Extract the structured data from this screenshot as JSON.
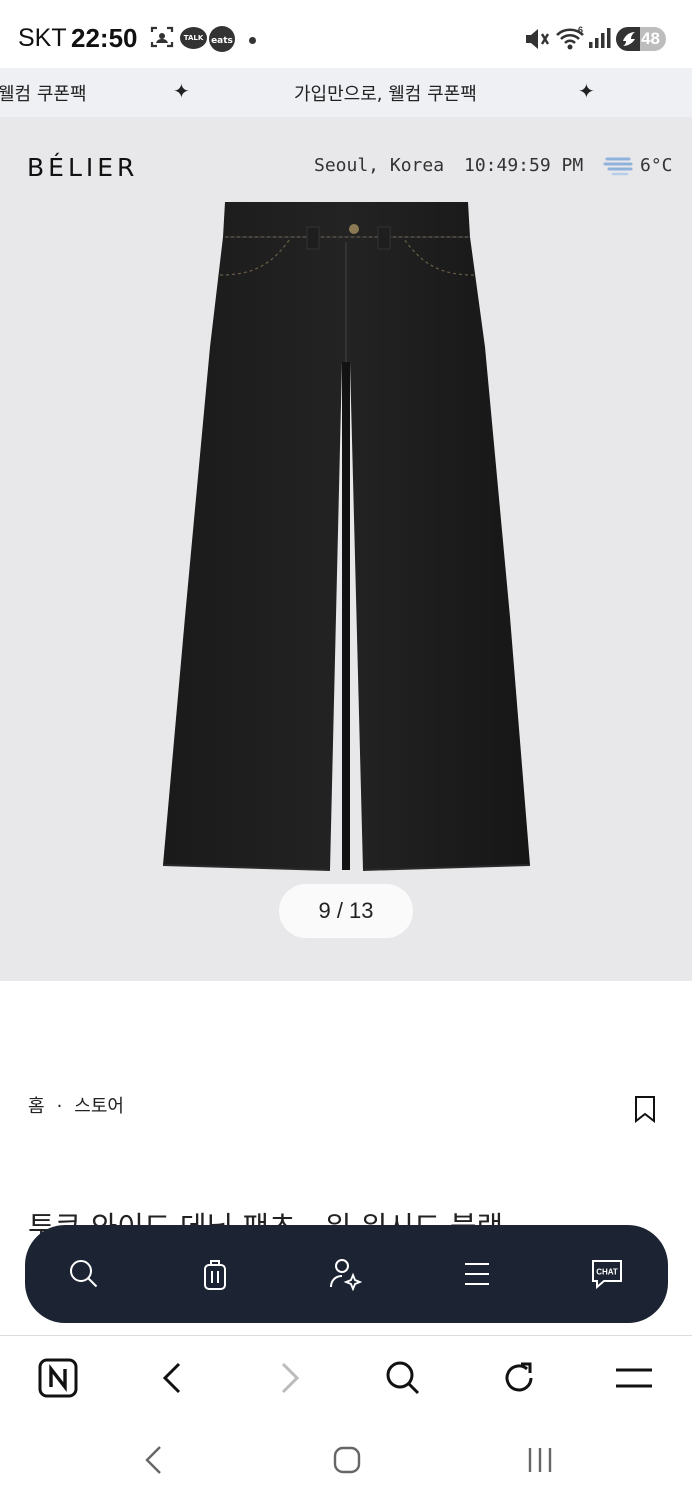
{
  "status_bar": {
    "carrier": "SKT",
    "time": "22:50",
    "talk_label": "TALK",
    "eats_label": "eats",
    "battery": "48",
    "wifi_badge": "6"
  },
  "promo": {
    "left_text": "웰컴 쿠폰팩",
    "center_text": "가입만으로, 웰컴 쿠폰팩"
  },
  "header": {
    "logo": "BÉLIER",
    "location": "Seoul, Korea",
    "clock": "10:49:59 PM",
    "temperature": "6°C"
  },
  "gallery": {
    "counter": "9 / 13",
    "current": 9,
    "total": 13
  },
  "breadcrumb": {
    "home": "홈",
    "separator": "·",
    "store": "스토어"
  },
  "product": {
    "title": "투쿠 와이드 데님 팬츠 - 워 워시드 블랙"
  },
  "float_nav": {
    "items": [
      {
        "name": "search",
        "icon": "search-icon"
      },
      {
        "name": "cart",
        "icon": "bag-icon"
      },
      {
        "name": "account",
        "icon": "user-icon"
      },
      {
        "name": "menu",
        "icon": "menu-icon"
      },
      {
        "name": "chat",
        "icon": "chat-icon",
        "label": "CHAT"
      }
    ]
  },
  "browser_bar": {
    "items": [
      "naver-icon",
      "back-icon",
      "forward-icon",
      "search-icon",
      "reload-icon",
      "menu-icon"
    ]
  },
  "system_nav": {
    "items": [
      "back-icon",
      "home-icon",
      "recents-icon"
    ]
  },
  "colors": {
    "hero_bg": "#e8e8ea",
    "promo_bg": "#eef0f3",
    "float_nav_bg": "#1c2333"
  }
}
